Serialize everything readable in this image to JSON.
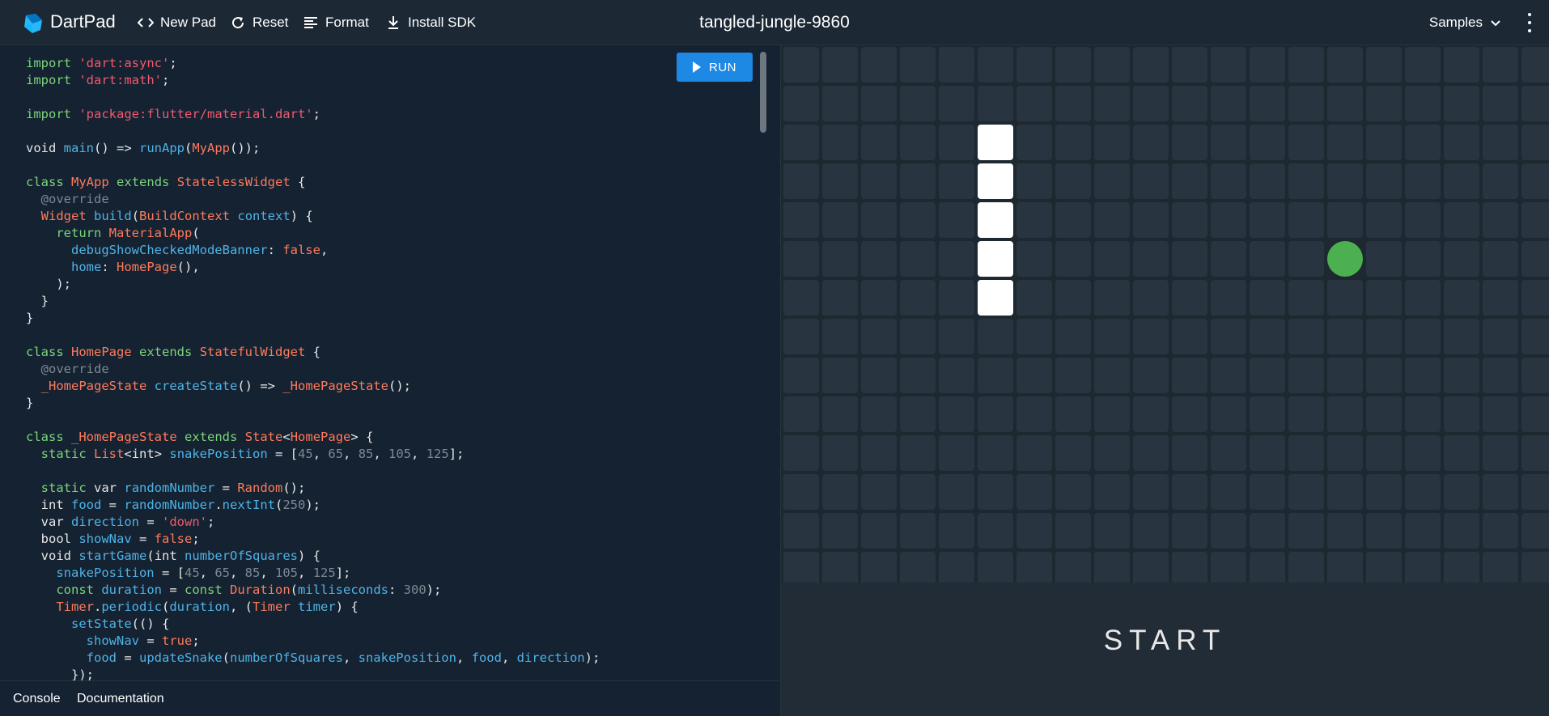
{
  "header": {
    "app_name": "DartPad",
    "new_pad_label": "New Pad",
    "reset_label": "Reset",
    "format_label": "Format",
    "install_sdk_label": "Install SDK",
    "pad_title": "tangled-jungle-9860",
    "samples_label": "Samples"
  },
  "editor": {
    "run_label": "RUN",
    "code_lines": [
      [
        [
          "kw",
          "import"
        ],
        [
          "p",
          " "
        ],
        [
          "str",
          "'dart:async'"
        ],
        [
          "p",
          ";"
        ]
      ],
      [
        [
          "kw",
          "import"
        ],
        [
          "p",
          " "
        ],
        [
          "str",
          "'dart:math'"
        ],
        [
          "p",
          ";"
        ]
      ],
      [],
      [
        [
          "kw",
          "import"
        ],
        [
          "p",
          " "
        ],
        [
          "str",
          "'package:flutter/material.dart'"
        ],
        [
          "p",
          ";"
        ]
      ],
      [],
      [
        [
          "kw2",
          "void"
        ],
        [
          "p",
          " "
        ],
        [
          "fn",
          "main"
        ],
        [
          "p",
          "() => "
        ],
        [
          "fn",
          "runApp"
        ],
        [
          "p",
          "("
        ],
        [
          "ty",
          "MyApp"
        ],
        [
          "p",
          "());"
        ]
      ],
      [],
      [
        [
          "kw",
          "class"
        ],
        [
          "p",
          " "
        ],
        [
          "ty",
          "MyApp"
        ],
        [
          "p",
          " "
        ],
        [
          "kw",
          "extends"
        ],
        [
          "p",
          " "
        ],
        [
          "ty",
          "StatelessWidget"
        ],
        [
          "p",
          " {"
        ]
      ],
      [
        [
          "p",
          "  "
        ],
        [
          "ann",
          "@override"
        ]
      ],
      [
        [
          "p",
          "  "
        ],
        [
          "ty",
          "Widget"
        ],
        [
          "p",
          " "
        ],
        [
          "fn",
          "build"
        ],
        [
          "p",
          "("
        ],
        [
          "ty",
          "BuildContext"
        ],
        [
          "p",
          " "
        ],
        [
          "fn",
          "context"
        ],
        [
          "p",
          ") {"
        ]
      ],
      [
        [
          "p",
          "    "
        ],
        [
          "kw",
          "return"
        ],
        [
          "p",
          " "
        ],
        [
          "ty",
          "MaterialApp"
        ],
        [
          "p",
          "("
        ]
      ],
      [
        [
          "p",
          "      "
        ],
        [
          "fn",
          "debugShowCheckedModeBanner"
        ],
        [
          "p",
          ": "
        ],
        [
          "lit",
          "false"
        ],
        [
          "p",
          ","
        ]
      ],
      [
        [
          "p",
          "      "
        ],
        [
          "fn",
          "home"
        ],
        [
          "p",
          ": "
        ],
        [
          "ty",
          "HomePage"
        ],
        [
          "p",
          "(),"
        ]
      ],
      [
        [
          "p",
          "    );"
        ]
      ],
      [
        [
          "p",
          "  }"
        ]
      ],
      [
        [
          "p",
          "}"
        ]
      ],
      [],
      [
        [
          "kw",
          "class"
        ],
        [
          "p",
          " "
        ],
        [
          "ty",
          "HomePage"
        ],
        [
          "p",
          " "
        ],
        [
          "kw",
          "extends"
        ],
        [
          "p",
          " "
        ],
        [
          "ty",
          "StatefulWidget"
        ],
        [
          "p",
          " {"
        ]
      ],
      [
        [
          "p",
          "  "
        ],
        [
          "ann",
          "@override"
        ]
      ],
      [
        [
          "p",
          "  "
        ],
        [
          "ty",
          "_HomePageState"
        ],
        [
          "p",
          " "
        ],
        [
          "fn",
          "createState"
        ],
        [
          "p",
          "() => "
        ],
        [
          "ty",
          "_HomePageState"
        ],
        [
          "p",
          "();"
        ]
      ],
      [
        [
          "p",
          "}"
        ]
      ],
      [],
      [
        [
          "kw",
          "class"
        ],
        [
          "p",
          " "
        ],
        [
          "ty",
          "_HomePageState"
        ],
        [
          "p",
          " "
        ],
        [
          "kw",
          "extends"
        ],
        [
          "p",
          " "
        ],
        [
          "ty",
          "State"
        ],
        [
          "p",
          "<"
        ],
        [
          "ty",
          "HomePage"
        ],
        [
          "p",
          "> {"
        ]
      ],
      [
        [
          "p",
          "  "
        ],
        [
          "kw",
          "static"
        ],
        [
          "p",
          " "
        ],
        [
          "ty",
          "List"
        ],
        [
          "p",
          "<"
        ],
        [
          "kw2",
          "int"
        ],
        [
          "p",
          "> "
        ],
        [
          "fn",
          "snakePosition"
        ],
        [
          "p",
          " = ["
        ],
        [
          "num",
          "45"
        ],
        [
          "p",
          ", "
        ],
        [
          "num",
          "65"
        ],
        [
          "p",
          ", "
        ],
        [
          "num",
          "85"
        ],
        [
          "p",
          ", "
        ],
        [
          "num",
          "105"
        ],
        [
          "p",
          ", "
        ],
        [
          "num",
          "125"
        ],
        [
          "p",
          "];"
        ]
      ],
      [],
      [
        [
          "p",
          "  "
        ],
        [
          "kw",
          "static"
        ],
        [
          "p",
          " "
        ],
        [
          "kw2",
          "var"
        ],
        [
          "p",
          " "
        ],
        [
          "fn",
          "randomNumber"
        ],
        [
          "p",
          " = "
        ],
        [
          "ty",
          "Random"
        ],
        [
          "p",
          "();"
        ]
      ],
      [
        [
          "p",
          "  "
        ],
        [
          "kw2",
          "int"
        ],
        [
          "p",
          " "
        ],
        [
          "fn",
          "food"
        ],
        [
          "p",
          " = "
        ],
        [
          "fn",
          "randomNumber"
        ],
        [
          "p",
          "."
        ],
        [
          "fn",
          "nextInt"
        ],
        [
          "p",
          "("
        ],
        [
          "num",
          "250"
        ],
        [
          "p",
          ");"
        ]
      ],
      [
        [
          "p",
          "  "
        ],
        [
          "kw2",
          "var"
        ],
        [
          "p",
          " "
        ],
        [
          "fn",
          "direction"
        ],
        [
          "p",
          " = "
        ],
        [
          "str",
          "'down'"
        ],
        [
          "p",
          ";"
        ]
      ],
      [
        [
          "p",
          "  "
        ],
        [
          "kw2",
          "bool"
        ],
        [
          "p",
          " "
        ],
        [
          "fn",
          "showNav"
        ],
        [
          "p",
          " = "
        ],
        [
          "lit",
          "false"
        ],
        [
          "p",
          ";"
        ]
      ],
      [
        [
          "p",
          "  "
        ],
        [
          "kw2",
          "void"
        ],
        [
          "p",
          " "
        ],
        [
          "fn",
          "startGame"
        ],
        [
          "p",
          "("
        ],
        [
          "kw2",
          "int"
        ],
        [
          "p",
          " "
        ],
        [
          "fn",
          "numberOfSquares"
        ],
        [
          "p",
          ") {"
        ]
      ],
      [
        [
          "p",
          "    "
        ],
        [
          "fn",
          "snakePosition"
        ],
        [
          "p",
          " = ["
        ],
        [
          "num",
          "45"
        ],
        [
          "p",
          ", "
        ],
        [
          "num",
          "65"
        ],
        [
          "p",
          ", "
        ],
        [
          "num",
          "85"
        ],
        [
          "p",
          ", "
        ],
        [
          "num",
          "105"
        ],
        [
          "p",
          ", "
        ],
        [
          "num",
          "125"
        ],
        [
          "p",
          "];"
        ]
      ],
      [
        [
          "p",
          "    "
        ],
        [
          "kw",
          "const"
        ],
        [
          "p",
          " "
        ],
        [
          "fn",
          "duration"
        ],
        [
          "p",
          " = "
        ],
        [
          "kw",
          "const"
        ],
        [
          "p",
          " "
        ],
        [
          "ty",
          "Duration"
        ],
        [
          "p",
          "("
        ],
        [
          "fn",
          "milliseconds"
        ],
        [
          "p",
          ": "
        ],
        [
          "num",
          "300"
        ],
        [
          "p",
          ");"
        ]
      ],
      [
        [
          "p",
          "    "
        ],
        [
          "ty",
          "Timer"
        ],
        [
          "p",
          "."
        ],
        [
          "fn",
          "periodic"
        ],
        [
          "p",
          "("
        ],
        [
          "fn",
          "duration"
        ],
        [
          "p",
          ", ("
        ],
        [
          "ty",
          "Timer"
        ],
        [
          "p",
          " "
        ],
        [
          "fn",
          "timer"
        ],
        [
          "p",
          ") {"
        ]
      ],
      [
        [
          "p",
          "      "
        ],
        [
          "fn",
          "setState"
        ],
        [
          "p",
          "(() {"
        ]
      ],
      [
        [
          "p",
          "        "
        ],
        [
          "fn",
          "showNav"
        ],
        [
          "p",
          " = "
        ],
        [
          "lit",
          "true"
        ],
        [
          "p",
          ";"
        ]
      ],
      [
        [
          "p",
          "        "
        ],
        [
          "fn",
          "food"
        ],
        [
          "p",
          " = "
        ],
        [
          "fn",
          "updateSnake"
        ],
        [
          "p",
          "("
        ],
        [
          "fn",
          "numberOfSquares"
        ],
        [
          "p",
          ", "
        ],
        [
          "fn",
          "snakePosition"
        ],
        [
          "p",
          ", "
        ],
        [
          "fn",
          "food"
        ],
        [
          "p",
          ", "
        ],
        [
          "fn",
          "direction"
        ],
        [
          "p",
          ");"
        ]
      ],
      [
        [
          "p",
          "      });"
        ]
      ]
    ]
  },
  "footer": {
    "console_label": "Console",
    "documentation_label": "Documentation"
  },
  "game": {
    "columns": 20,
    "visible_rows": 14,
    "snake_position": [
      45,
      65,
      85,
      105,
      125
    ],
    "food_index": 114,
    "start_label": "START",
    "colors": {
      "cell": "#283440",
      "snake": "#ffffff",
      "food": "#4caf50",
      "accent": "#1e88e5"
    }
  }
}
